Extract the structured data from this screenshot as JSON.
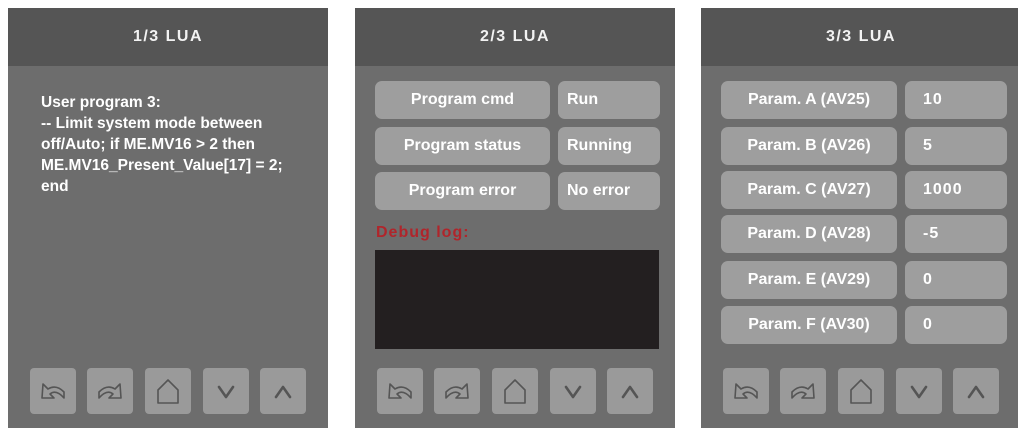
{
  "panels": [
    {
      "title": "1/3 LUA",
      "program_text": "User program 3:\n-- Limit system mode between off/Auto; if ME.MV16 > 2 then ME.MV16_Present_Value[17] = 2; end"
    },
    {
      "title": "2/3 LUA",
      "rows": [
        {
          "label": "Program cmd",
          "value": "Run"
        },
        {
          "label": "Program status",
          "value": "Running"
        },
        {
          "label": "Program error",
          "value": "No error"
        }
      ],
      "debug_label": "Debug log:"
    },
    {
      "title": "3/3 LUA",
      "rows": [
        {
          "label": "Param. A (AV25)",
          "value": "10"
        },
        {
          "label": "Param. B (AV26)",
          "value": "5"
        },
        {
          "label": "Param. C (AV27)",
          "value": "1000"
        },
        {
          "label": "Param. D (AV28)",
          "value": "-5"
        },
        {
          "label": "Param. E (AV29)",
          "value": "0"
        },
        {
          "label": "Param. F (AV30)",
          "value": "0"
        }
      ]
    }
  ],
  "nav_buttons": [
    "back-icon",
    "forward-icon",
    "home-icon",
    "down-arrow-icon",
    "up-arrow-icon"
  ],
  "colors": {
    "panel_bg": "#6d6d6d",
    "header_bg": "#555555",
    "field_bg": "#9e9e9e",
    "debug_label": "#b0252b",
    "debug_box": "#231f20"
  }
}
